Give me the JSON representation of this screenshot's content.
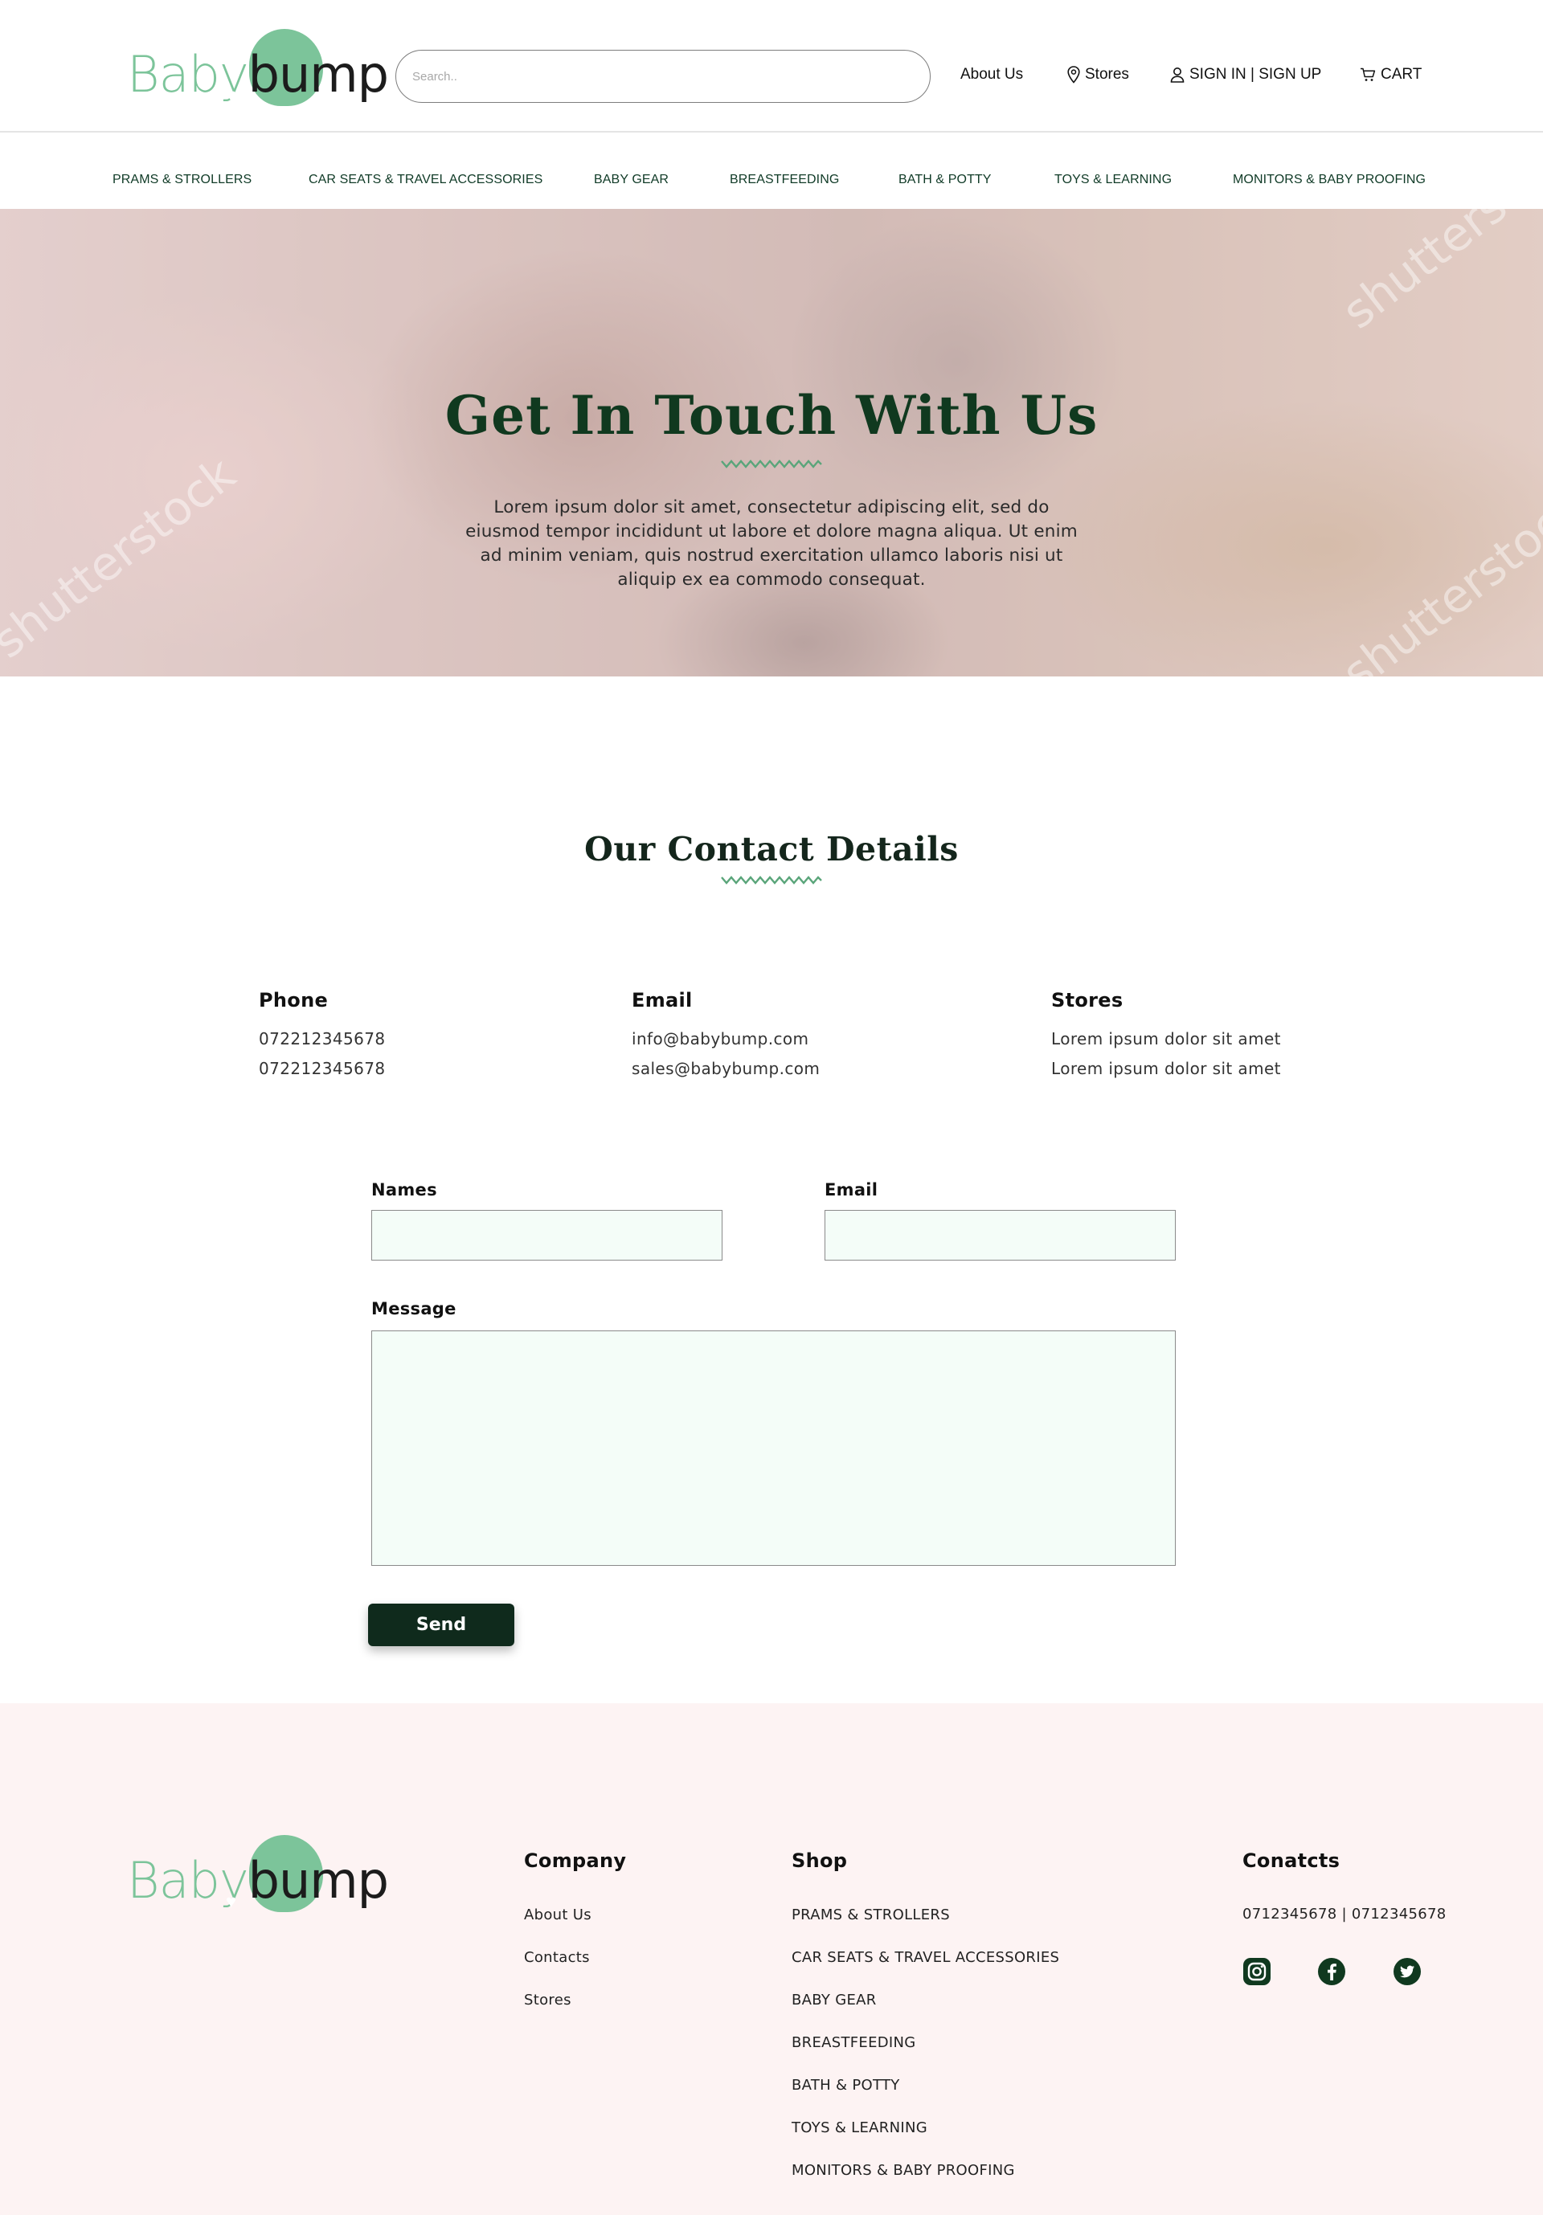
{
  "brand": {
    "logo_part1": "Baby",
    "logo_part2": "bump",
    "logo_heart": "♥"
  },
  "header": {
    "search": {
      "placeholder": "Search..",
      "value": ""
    },
    "nav": [
      {
        "label": "About Us",
        "icon": ""
      },
      {
        "label": "Stores",
        "icon": "map-pin-icon"
      },
      {
        "label": "SIGN IN | SIGN UP",
        "icon": "user-icon"
      },
      {
        "label": "CART",
        "icon": "cart-icon"
      }
    ]
  },
  "categories": [
    "PRAMS & STROLLERS",
    "CAR SEATS & TRAVEL ACCESSORIES",
    "BABY GEAR",
    "BREASTFEEDING",
    "BATH & POTTY",
    "TOYS & LEARNING",
    "MONITORS & BABY PROOFING"
  ],
  "hero": {
    "title": "Get In Touch With Us",
    "text": "Lorem ipsum dolor sit amet, consectetur adipiscing elit, sed do eiusmod tempor incididunt ut labore et dolore magna aliqua. Ut enim ad minim veniam, quis nostrud exercitation ullamco laboris nisi ut aliquip ex ea commodo consequat.",
    "watermark": "shutterstock"
  },
  "contact": {
    "title": "Our Contact Details",
    "columns": [
      {
        "heading": "Phone",
        "lines": [
          "072212345678",
          "072212345678"
        ]
      },
      {
        "heading": "Email",
        "lines": [
          "info@babybump.com",
          "sales@babybump.com"
        ]
      },
      {
        "heading": "Stores",
        "lines": [
          "Lorem ipsum dolor sit amet",
          "Lorem ipsum dolor sit amet"
        ]
      }
    ]
  },
  "form": {
    "names_label": "Names",
    "names_value": "",
    "email_label": "Email",
    "email_value": "",
    "message_label": "Message",
    "message_value": "",
    "send_label": "Send"
  },
  "footer": {
    "company": {
      "heading": "Company",
      "links": [
        "About Us",
        "Contacts",
        "Stores"
      ]
    },
    "shop": {
      "heading": "Shop",
      "links": [
        "PRAMS & STROLLERS",
        "CAR SEATS & TRAVEL ACCESSORIES",
        "BABY GEAR",
        "BREASTFEEDING",
        "BATH & POTTY",
        "TOYS & LEARNING",
        "MONITORS & BABY PROOFING"
      ]
    },
    "contacts": {
      "heading": "Conatcts",
      "phones": "0712345678 |   0712345678",
      "social": [
        "instagram-icon",
        "facebook-icon",
        "twitter-icon"
      ]
    }
  },
  "colors": {
    "brand_green": "#7cc49a",
    "dark_green": "#10391f",
    "button": "#0f2a1c",
    "input_bg": "#f4fdf8",
    "footer_bg": "#fdf3f3"
  }
}
